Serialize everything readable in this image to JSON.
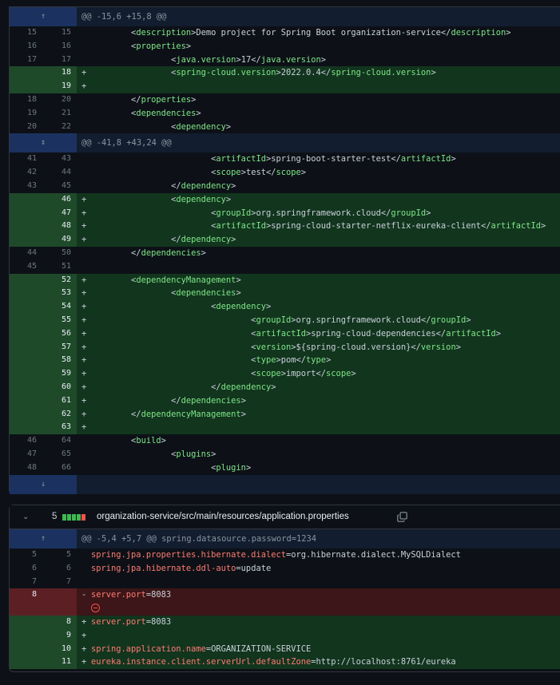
{
  "diff1": {
    "hunks": [
      {
        "header": "@@ -15,6 +15,8 @@",
        "lines": [
          {
            "type": "ctx",
            "old": "15",
            "new": "15",
            "text": "        <description>Demo project for Spring Boot organization-service</description>"
          },
          {
            "type": "ctx",
            "old": "16",
            "new": "16",
            "text": "        <properties>"
          },
          {
            "type": "ctx",
            "old": "17",
            "new": "17",
            "text": "                <java.version>17</java.version>"
          },
          {
            "type": "add",
            "old": "",
            "new": "18",
            "text": "                <spring-cloud.version>2022.0.4</spring-cloud.version>"
          },
          {
            "type": "add",
            "old": "",
            "new": "19",
            "text": ""
          },
          {
            "type": "ctx",
            "old": "18",
            "new": "20",
            "text": "        </properties>"
          },
          {
            "type": "ctx",
            "old": "19",
            "new": "21",
            "text": "        <dependencies>"
          },
          {
            "type": "ctx",
            "old": "20",
            "new": "22",
            "text": "                <dependency>"
          }
        ]
      },
      {
        "header": "@@ -41,8 +43,24 @@",
        "lines": [
          {
            "type": "ctx",
            "old": "41",
            "new": "43",
            "text": "                        <artifactId>spring-boot-starter-test</artifactId>"
          },
          {
            "type": "ctx",
            "old": "42",
            "new": "44",
            "text": "                        <scope>test</scope>"
          },
          {
            "type": "ctx",
            "old": "43",
            "new": "45",
            "text": "                </dependency>"
          },
          {
            "type": "add",
            "old": "",
            "new": "46",
            "text": "                <dependency>"
          },
          {
            "type": "add",
            "old": "",
            "new": "47",
            "text": "                        <groupId>org.springframework.cloud</groupId>"
          },
          {
            "type": "add",
            "old": "",
            "new": "48",
            "text": "                        <artifactId>spring-cloud-starter-netflix-eureka-client</artifactId>"
          },
          {
            "type": "add",
            "old": "",
            "new": "49",
            "text": "                </dependency>"
          },
          {
            "type": "ctx",
            "old": "44",
            "new": "50",
            "text": "        </dependencies>"
          },
          {
            "type": "ctx",
            "old": "45",
            "new": "51",
            "text": ""
          },
          {
            "type": "add",
            "old": "",
            "new": "52",
            "text": "        <dependencyManagement>"
          },
          {
            "type": "add",
            "old": "",
            "new": "53",
            "text": "                <dependencies>"
          },
          {
            "type": "add",
            "old": "",
            "new": "54",
            "text": "                        <dependency>"
          },
          {
            "type": "add",
            "old": "",
            "new": "55",
            "text": "                                <groupId>org.springframework.cloud</groupId>"
          },
          {
            "type": "add",
            "old": "",
            "new": "56",
            "text": "                                <artifactId>spring-cloud-dependencies</artifactId>"
          },
          {
            "type": "add",
            "old": "",
            "new": "57",
            "text": "                                <version>${spring-cloud.version}</version>"
          },
          {
            "type": "add",
            "old": "",
            "new": "58",
            "text": "                                <type>pom</type>"
          },
          {
            "type": "add",
            "old": "",
            "new": "59",
            "text": "                                <scope>import</scope>"
          },
          {
            "type": "add",
            "old": "",
            "new": "60",
            "text": "                        </dependency>"
          },
          {
            "type": "add",
            "old": "",
            "new": "61",
            "text": "                </dependencies>"
          },
          {
            "type": "add",
            "old": "",
            "new": "62",
            "text": "        </dependencyManagement>"
          },
          {
            "type": "add",
            "old": "",
            "new": "63",
            "text": ""
          },
          {
            "type": "ctx",
            "old": "46",
            "new": "64",
            "text": "        <build>"
          },
          {
            "type": "ctx",
            "old": "47",
            "new": "65",
            "text": "                <plugins>"
          },
          {
            "type": "ctx",
            "old": "48",
            "new": "66",
            "text": "                        <plugin>"
          }
        ]
      }
    ]
  },
  "diff2": {
    "file": {
      "change_count": "5",
      "path": "organization-service/src/main/resources/application.properties"
    },
    "hunk_header": "@@ -5,4 +5,7 @@ spring.datasource.password=1234",
    "lines": [
      {
        "type": "ctx",
        "old": "5",
        "new": "5",
        "key": "spring.jpa.properties.hibernate.dialect",
        "val": "=org.hibernate.dialect.MySQLDialect"
      },
      {
        "type": "ctx",
        "old": "6",
        "new": "6",
        "key": "spring.jpa.hibernate.ddl-auto",
        "val": "=update"
      },
      {
        "type": "ctx",
        "old": "7",
        "new": "7",
        "key": "",
        "val": ""
      },
      {
        "type": "del",
        "old": "8",
        "new": "",
        "key": "server.port",
        "val": "=8083"
      },
      {
        "type": "add",
        "old": "",
        "new": "8",
        "key": "server.port",
        "val": "=8083"
      },
      {
        "type": "add",
        "old": "",
        "new": "9",
        "key": "",
        "val": ""
      },
      {
        "type": "add",
        "old": "",
        "new": "10",
        "key": "spring.application.name",
        "val": "=ORGANIZATION-SERVICE"
      },
      {
        "type": "add",
        "old": "",
        "new": "11",
        "key": "eureka.instance.client.serverUrl.defaultZone",
        "val": "=http://localhost:8761/eureka"
      }
    ]
  },
  "icons": [
    "expand-up-icon",
    "expand-both-icon",
    "expand-down-icon",
    "chevron-down-icon",
    "copy-icon",
    "minus-circle-icon"
  ],
  "colors": {
    "add": "#12351e",
    "add_num": "#1f4a2a",
    "del": "#3c1618",
    "del_num": "#5c1f24",
    "tag": "#7ee787",
    "key": "#ff7b72",
    "bg": "#0d1117"
  }
}
